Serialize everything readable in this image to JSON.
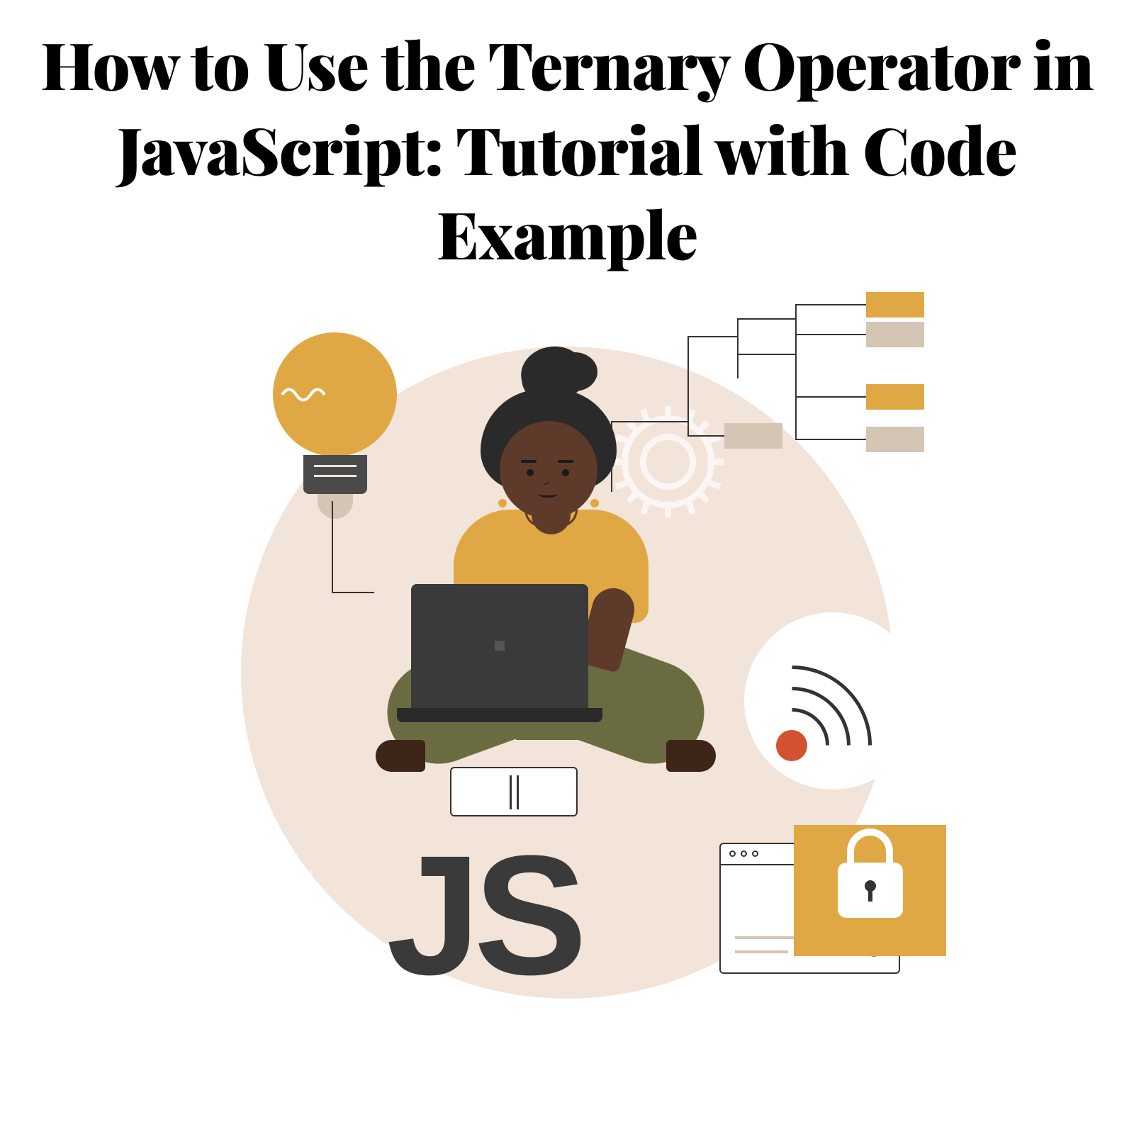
{
  "title": "How to Use the Ternary Operator in JavaScript: Tutorial with Code Example",
  "logo_text": "JS",
  "colors": {
    "accent_yellow": "#e0a845",
    "accent_orange": "#d35230",
    "olive": "#6b6b42",
    "skin": "#5d3a2a",
    "dark": "#3a3a3a",
    "beige": "#d4c5b5",
    "bg_circle": "#f2e4d9"
  },
  "icons": {
    "lightbulb": "lightbulb-icon",
    "gear": "gear-icon",
    "wifi": "wifi-icon",
    "lock": "lock-icon",
    "diagram": "tree-diagram-icon"
  }
}
